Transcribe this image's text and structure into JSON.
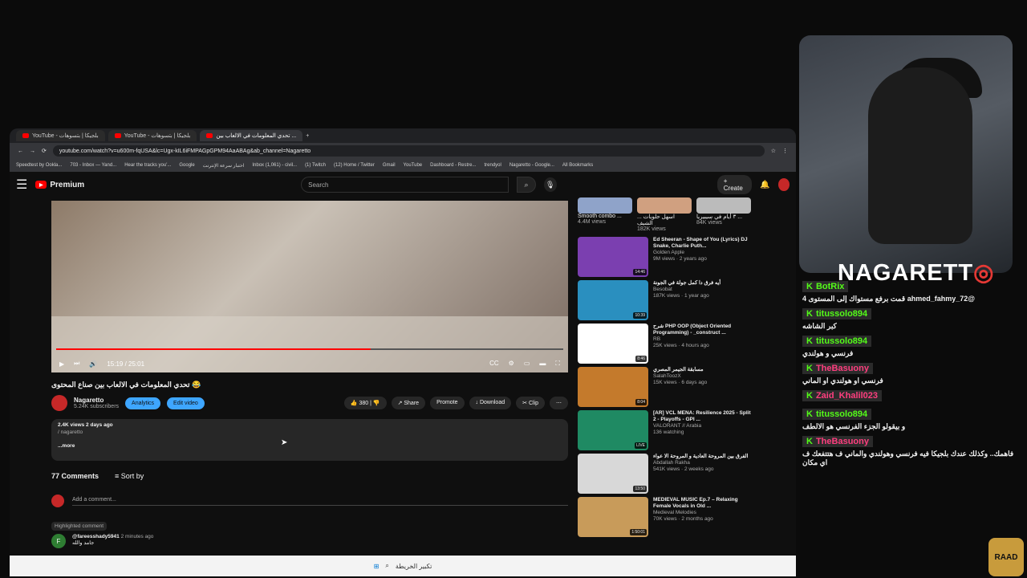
{
  "browser": {
    "tabs": [
      {
        "label": "YouTube - بلجيكا | بتسوهات"
      },
      {
        "label": "YouTube - بلجيكا | بتسوهات"
      },
      {
        "label": "تحدي المعلومات في الالعاب بين ..."
      }
    ],
    "url": "youtube.com/watch?v=u600m-fqUSA&lc=Ugx-kIL6iFMPAGpGPM94AaABAg&ab_channel=Nagaretto",
    "bookmarks": [
      "Speedtest by Ookla...",
      "703 - Inbox — Yand...",
      "Hear the tracks you'...",
      "Google",
      "اختبار سرعة الإنترنت",
      "Inbox (1,061) - civil...",
      "(1) Twitch",
      "(12) Home / Twitter",
      "Gmail",
      "YouTube",
      "Dashboard - Restre...",
      "trendyol",
      "Nagaretto - Google...",
      "All Bookmarks"
    ]
  },
  "youtube": {
    "logo": "Premium",
    "search_placeholder": "Search",
    "create": "Create",
    "video": {
      "time": "15:19 / 25:01",
      "progress_fraction": 0.62
    },
    "title": "تحدي المعلومات في الالعاب بين صناع المحتوى 😂",
    "channel": {
      "name": "Nagaretto",
      "subs": "5.24K subscribers",
      "analytics": "Analytics",
      "edit": "Edit video"
    },
    "actions": {
      "likes": "380",
      "share": "Share",
      "promote": "Promote",
      "download": "Download",
      "clip": "Clip"
    },
    "description": {
      "line1": "2.4K views  2 days ago",
      "line2": "/ nagaretto",
      "more": "...more"
    },
    "comments": {
      "count": "77 Comments",
      "sort": "Sort by",
      "add": "Add a comment...",
      "highlighted": "Highlighted comment",
      "author": "@fareesshady5941",
      "time": "2 minutes ago",
      "text": "جامد والله"
    },
    "shorts": [
      {
        "title": "Smooth combo ...",
        "views": "4.4M views"
      },
      {
        "title": "اسهل حلويات ... الشيف",
        "views": "182K views"
      },
      {
        "title": "٣ أيام في سيبيريا ...",
        "views": "84K views"
      }
    ],
    "recommendations": [
      {
        "title": "Ed Sheeran - Shape of You (Lyrics) DJ Snake, Charlie Puth...",
        "channel": "Golden Apple",
        "meta": "9M views · 2 years ago",
        "duration": "14:46",
        "color": "#7b3fb0"
      },
      {
        "title": "أيه فرق دا كمل جولة في الجونة",
        "channel": "Besobat",
        "meta": "187K views · 1 year ago",
        "duration": "10:39",
        "color": "#2a8fbf"
      },
      {
        "title": "شرح PHP OOP (Object Oriented Programming) - _construct ...",
        "channel": "RB",
        "meta": "25K views · 4 hours ago",
        "duration": "8:46",
        "color": "#ffffff"
      },
      {
        "title": "مسابقة الجيمر المصري",
        "channel": "SalahToozX",
        "meta": "15K views · 6 days ago",
        "duration": "8:04",
        "color": "#c47a2c"
      },
      {
        "title": "[AR] VCL MENA: Resilience 2025 - Split 2 - Playoffs - GPI ...",
        "channel": "VALORANT // Arabia",
        "meta": "136 watching",
        "duration": "LIVE",
        "color": "#1f8a63"
      },
      {
        "title": "الفرق بين المروحة العادية و المروحة الا عواء",
        "channel": "Abdallah Rakha",
        "meta": "541K views · 2 weeks ago",
        "duration": "13:50",
        "color": "#d8d8d8"
      },
      {
        "title": "MEDIEVAL MUSIC Ep.7 – Relaxing Female Vocals in Old ...",
        "channel": "Medieval Melodies",
        "meta": "70K views · 2 months ago",
        "duration": "1:50:01",
        "color": "#c89b5a"
      }
    ]
  },
  "stream": {
    "streamer": "NAGARETT",
    "chat": [
      {
        "user": "BotRix",
        "color": "#53fc18",
        "text": "@ahmed_fahmy_72 قمت برفع مستواك إلى المستوى 4"
      },
      {
        "user": "titussolo894",
        "color": "#53fc18",
        "text": "كبر الشاشه"
      },
      {
        "user": "titussolo894",
        "color": "#53fc18",
        "text": "فرنسي و هولندي"
      },
      {
        "user": "TheBasuony",
        "color": "#ff3e7f",
        "text": "فرنسي او هولندي او الماني"
      },
      {
        "user": "Zaid_Khalil023",
        "color": "#ff3e7f",
        "text": ""
      },
      {
        "user": "titussolo894",
        "color": "#53fc18",
        "text": "و بيقولو الجزء الفرنسي هو الالطف"
      },
      {
        "user": "TheBasuony",
        "color": "#ff3e7f",
        "text": "فاهمك.. وكذلك عندك بلجيكا فيه فرنسي وهولندي والماني ف هتتفعك ف اي مكان"
      }
    ],
    "badge": "RAAD"
  },
  "taskbar": {
    "label": "تكبير الخريطة"
  }
}
